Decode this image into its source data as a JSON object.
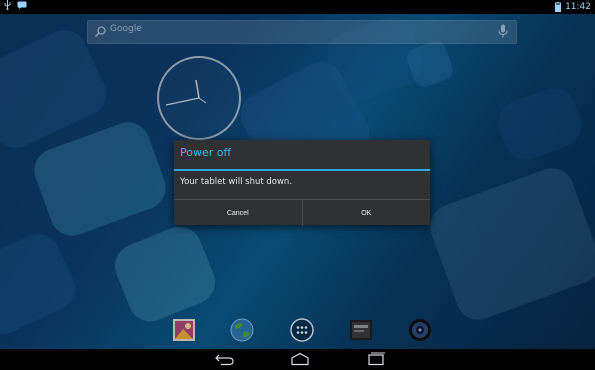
{
  "status_bar": {
    "time": "11:42"
  },
  "search": {
    "text": "Google"
  },
  "dialog": {
    "title": "Power off",
    "message": "Your tablet will shut down.",
    "cancel_label": "Cancel",
    "ok_label": "OK"
  },
  "dock": {
    "icons": [
      "gallery-icon",
      "browser-icon",
      "apps-icon",
      "camera-icon",
      "music-icon"
    ]
  },
  "navigation": {
    "icons": [
      "back-icon",
      "home-icon",
      "recents-icon"
    ]
  },
  "colors": {
    "dialog_accent": "#39b5e6",
    "dialog_bg": "#2f3133"
  }
}
